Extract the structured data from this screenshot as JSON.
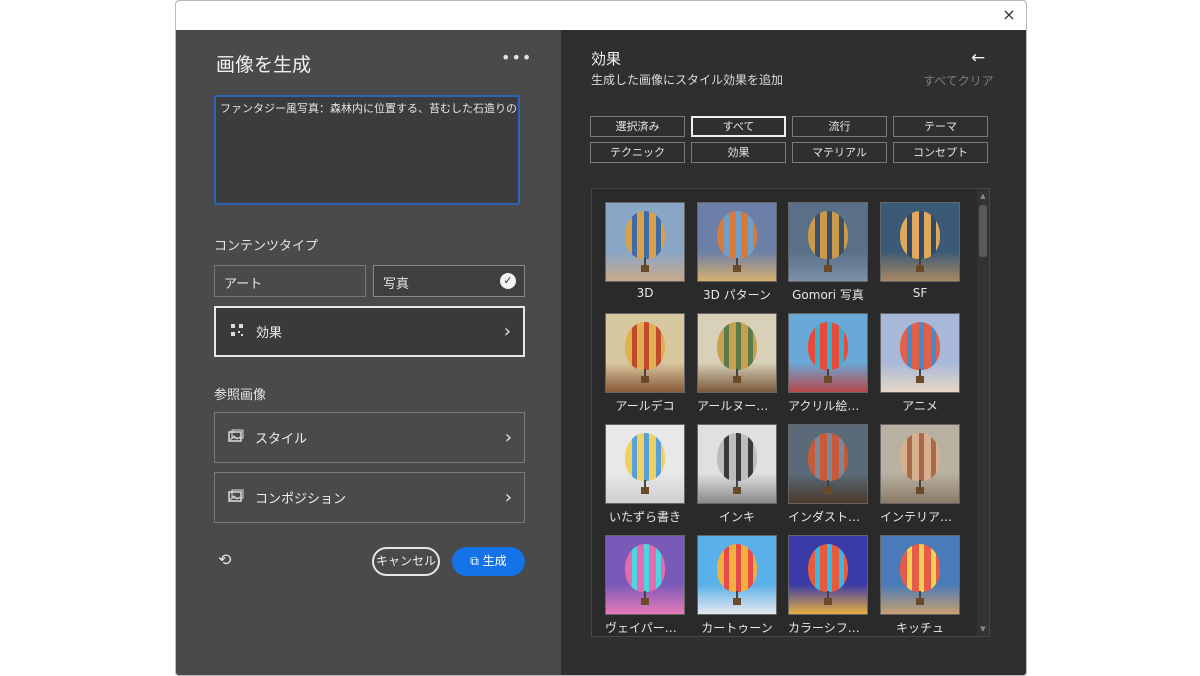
{
  "window": {
    "close_icon": "×"
  },
  "generate": {
    "title": "画像を生成",
    "more_icon": "•••",
    "prompt_text": "ファンタジー風写真：森林内に位置する、苔むした石造りの古橋",
    "content_type": {
      "label": "コンテンツタイプ",
      "options": [
        {
          "label": "アート",
          "selected": false
        },
        {
          "label": "写真",
          "selected": true
        }
      ],
      "check_icon": "✓"
    },
    "effects_row": {
      "label": "効果"
    },
    "reference": {
      "label": "参照画像",
      "style_label": "スタイル",
      "composition_label": "コンポジション"
    },
    "chevron": "›",
    "reset_icon": "⟲",
    "cancel_label": "キャンセル",
    "generate_label": "⧉ 生成"
  },
  "effects": {
    "title": "効果",
    "subtitle": "生成した画像にスタイル効果を追加",
    "back_icon": "←",
    "clear_all": "すべてクリア",
    "filters": [
      {
        "label": "選択済み",
        "active": false
      },
      {
        "label": "すべて",
        "active": true
      },
      {
        "label": "流行",
        "active": false
      },
      {
        "label": "テーマ",
        "active": false
      },
      {
        "label": "テクニック",
        "active": false
      },
      {
        "label": "効果",
        "active": false
      },
      {
        "label": "マテリアル",
        "active": false
      },
      {
        "label": "コンセプト",
        "active": false
      }
    ],
    "tiles": [
      {
        "label": "3D",
        "sky": "#8aa6c6",
        "ground": "#c8a98a",
        "balloon": "#d9a14a",
        "accent": "#3e6aa8"
      },
      {
        "label": "3D パターン",
        "sky": "#6b7fa8",
        "ground": "#d8b070",
        "balloon": "#d97a3a",
        "accent": "#6fa0c8"
      },
      {
        "label": "Gomori 写真",
        "sky": "#5a6f88",
        "ground": "#7a8fa8",
        "balloon": "#c89a4a",
        "accent": "#3b4f6a"
      },
      {
        "label": "SF",
        "sky": "#3b5a78",
        "ground": "#a88860",
        "balloon": "#e0a85a",
        "accent": "#2f4a6a"
      },
      {
        "label": "アールデコ",
        "sky": "#d8c8a0",
        "ground": "#8a5a3a",
        "balloon": "#e0b050",
        "accent": "#c24a2a"
      },
      {
        "label": "アールヌーボー",
        "sky": "#d8d0b8",
        "ground": "#7a5a3a",
        "balloon": "#c8a050",
        "accent": "#5a7a4a"
      },
      {
        "label": "アクリル絵の具",
        "sky": "#6aa8d8",
        "ground": "#b8484a",
        "balloon": "#e84a3a",
        "accent": "#3ab0d0"
      },
      {
        "label": "アニメ",
        "sky": "#a8b8d8",
        "ground": "#e8d8c8",
        "balloon": "#e0604a",
        "accent": "#4a8ac8"
      },
      {
        "label": "いたずら書き",
        "sky": "#e8e8e8",
        "ground": "#cfcfcf",
        "balloon": "#f0d060",
        "accent": "#5aa0d8"
      },
      {
        "label": "インキ",
        "sky": "#e0e0e0",
        "ground": "#8a8a8a",
        "balloon": "#bdbdbd",
        "accent": "#3a3a3a"
      },
      {
        "label": "インダストリアル",
        "sky": "#5a6a78",
        "ground": "#4a3a2a",
        "balloon": "#c85a3a",
        "accent": "#7a8a98"
      },
      {
        "label": "インテリアデ…",
        "sky": "#b8b0a0",
        "ground": "#8a7a68",
        "balloon": "#d8b090",
        "accent": "#a86a4a"
      },
      {
        "label": "ヴェイパーウェ…",
        "sky": "#7a5ab8",
        "ground": "#e87ab8",
        "balloon": "#e86ab0",
        "accent": "#4ad8e0"
      },
      {
        "label": "カートゥーン",
        "sky": "#5ab0e8",
        "ground": "#e8e8f0",
        "balloon": "#f0b040",
        "accent": "#e84a4a"
      },
      {
        "label": "カラーシフト …",
        "sky": "#3a3aa8",
        "ground": "#e8b040",
        "balloon": "#e85a3a",
        "accent": "#3ab8e8"
      },
      {
        "label": "キッチュ",
        "sky": "#4a7ab8",
        "ground": "#c8a070",
        "balloon": "#e85a4a",
        "accent": "#f0d050"
      }
    ],
    "scroll_up": "▲",
    "scroll_down": "▼"
  }
}
